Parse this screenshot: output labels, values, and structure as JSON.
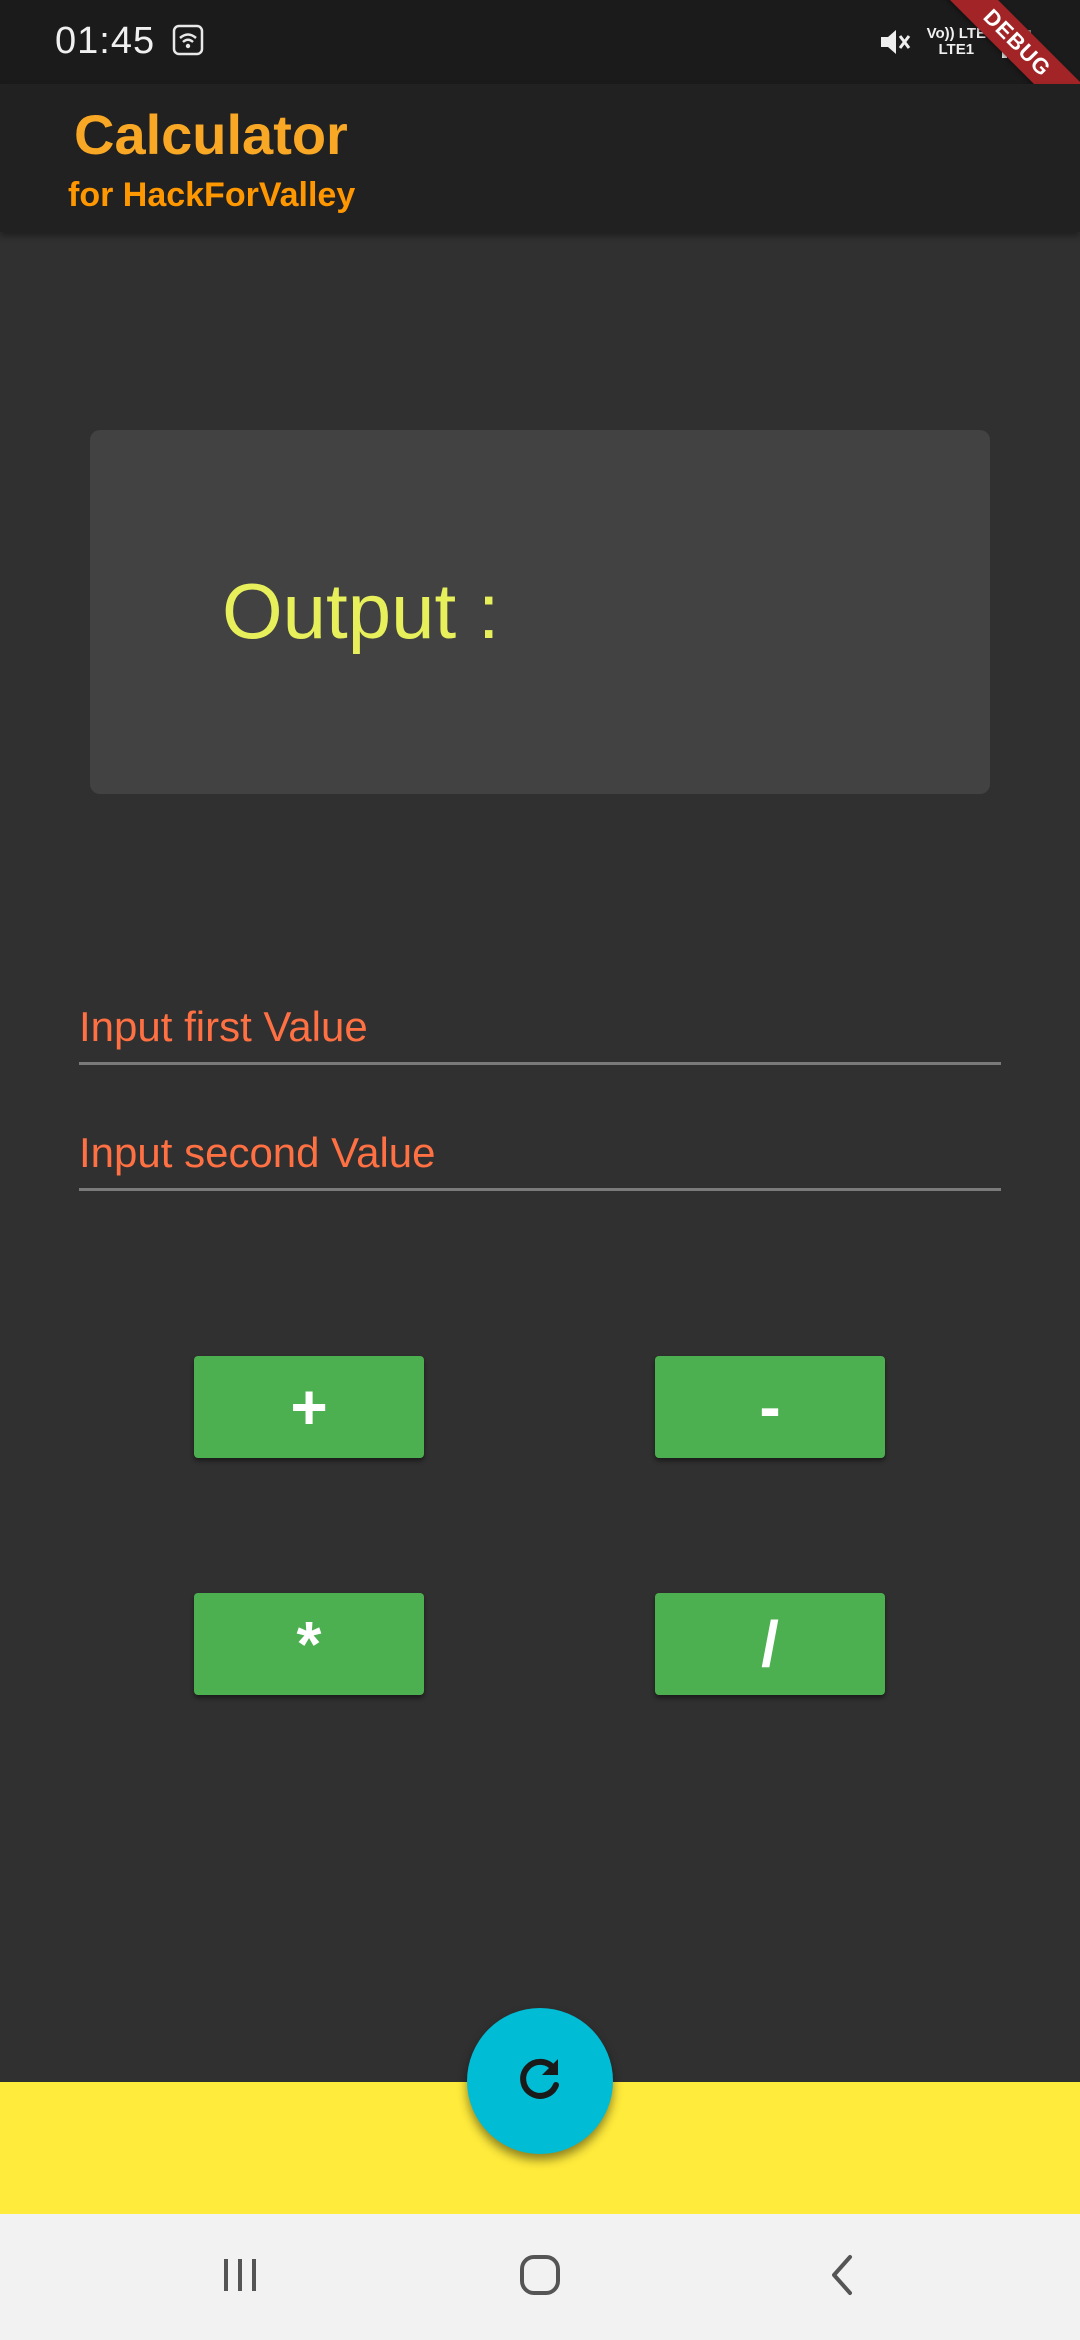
{
  "status_bar": {
    "time": "01:45",
    "network_line1": "Vo)) LTE",
    "network_line2": "LTE1",
    "debug_banner": "DEBUG"
  },
  "app_bar": {
    "title": "Calculator",
    "subtitle": "for HackForValley"
  },
  "output": {
    "label": "Output :"
  },
  "inputs": {
    "first_placeholder": "Input first Value",
    "second_placeholder": "Input second Value",
    "first_value": "",
    "second_value": ""
  },
  "operations": {
    "add": "+",
    "subtract": "-",
    "multiply": "*",
    "divide": "/"
  },
  "icons": {
    "fab": "refresh-icon",
    "nav_recents": "recents-icon",
    "nav_home": "home-icon",
    "nav_back": "back-icon",
    "status_wifi": "wifi-icon",
    "status_mute": "mute-icon",
    "status_signal": "signal-icon"
  },
  "colors": {
    "background": "#303030",
    "app_bar": "#212121",
    "title": "#f9a825",
    "subtitle": "#ff9800",
    "output_card": "#424242",
    "output_text": "#e7f05a",
    "placeholder": "#ff7043",
    "button": "#4caf50",
    "fab": "#00bcd4",
    "bottom_bar": "#ffeb3b",
    "debug_banner": "#a22426"
  }
}
